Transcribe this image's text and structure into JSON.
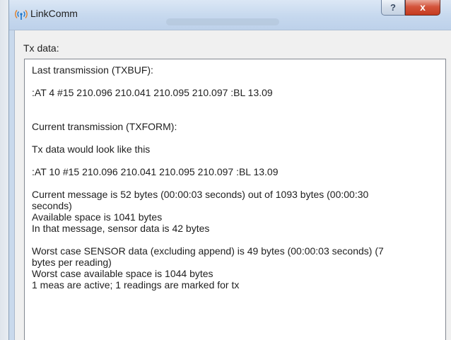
{
  "window": {
    "title": "LinkComm",
    "help_label": "?",
    "close_label": "x"
  },
  "tx": {
    "label": "Tx data:",
    "lines": {
      "last_heading": "Last transmission (TXBUF):",
      "last_value": ":AT 4 #15 210.096 210.041 210.095 210.097 :BL 13.09",
      "current_heading": "Current transmission (TXFORM):",
      "would_look": "Tx data would look like this",
      "current_value": ":AT 10 #15 210.096 210.041 210.095 210.097 :BL 13.09",
      "message_info": "Current message is 52 bytes (00:00:03 seconds) out of 1093 bytes (00:00:30\nseconds)\nAvailable space is 1041 bytes\nIn that message, sensor data is 42 bytes",
      "worst_case": "Worst case SENSOR data (excluding append) is 49 bytes (00:00:03 seconds) (7\nbytes per reading)\nWorst case available space is 1044 bytes\n1 meas are active; 1 readings are marked for tx"
    }
  },
  "colors": {
    "title_bar": "#c6d8ee",
    "close_button": "#c53a1f",
    "app_icon": "#1a73c8"
  },
  "icons": {
    "app": "wireless-antenna-icon",
    "help": "question-icon",
    "close": "close-icon"
  }
}
